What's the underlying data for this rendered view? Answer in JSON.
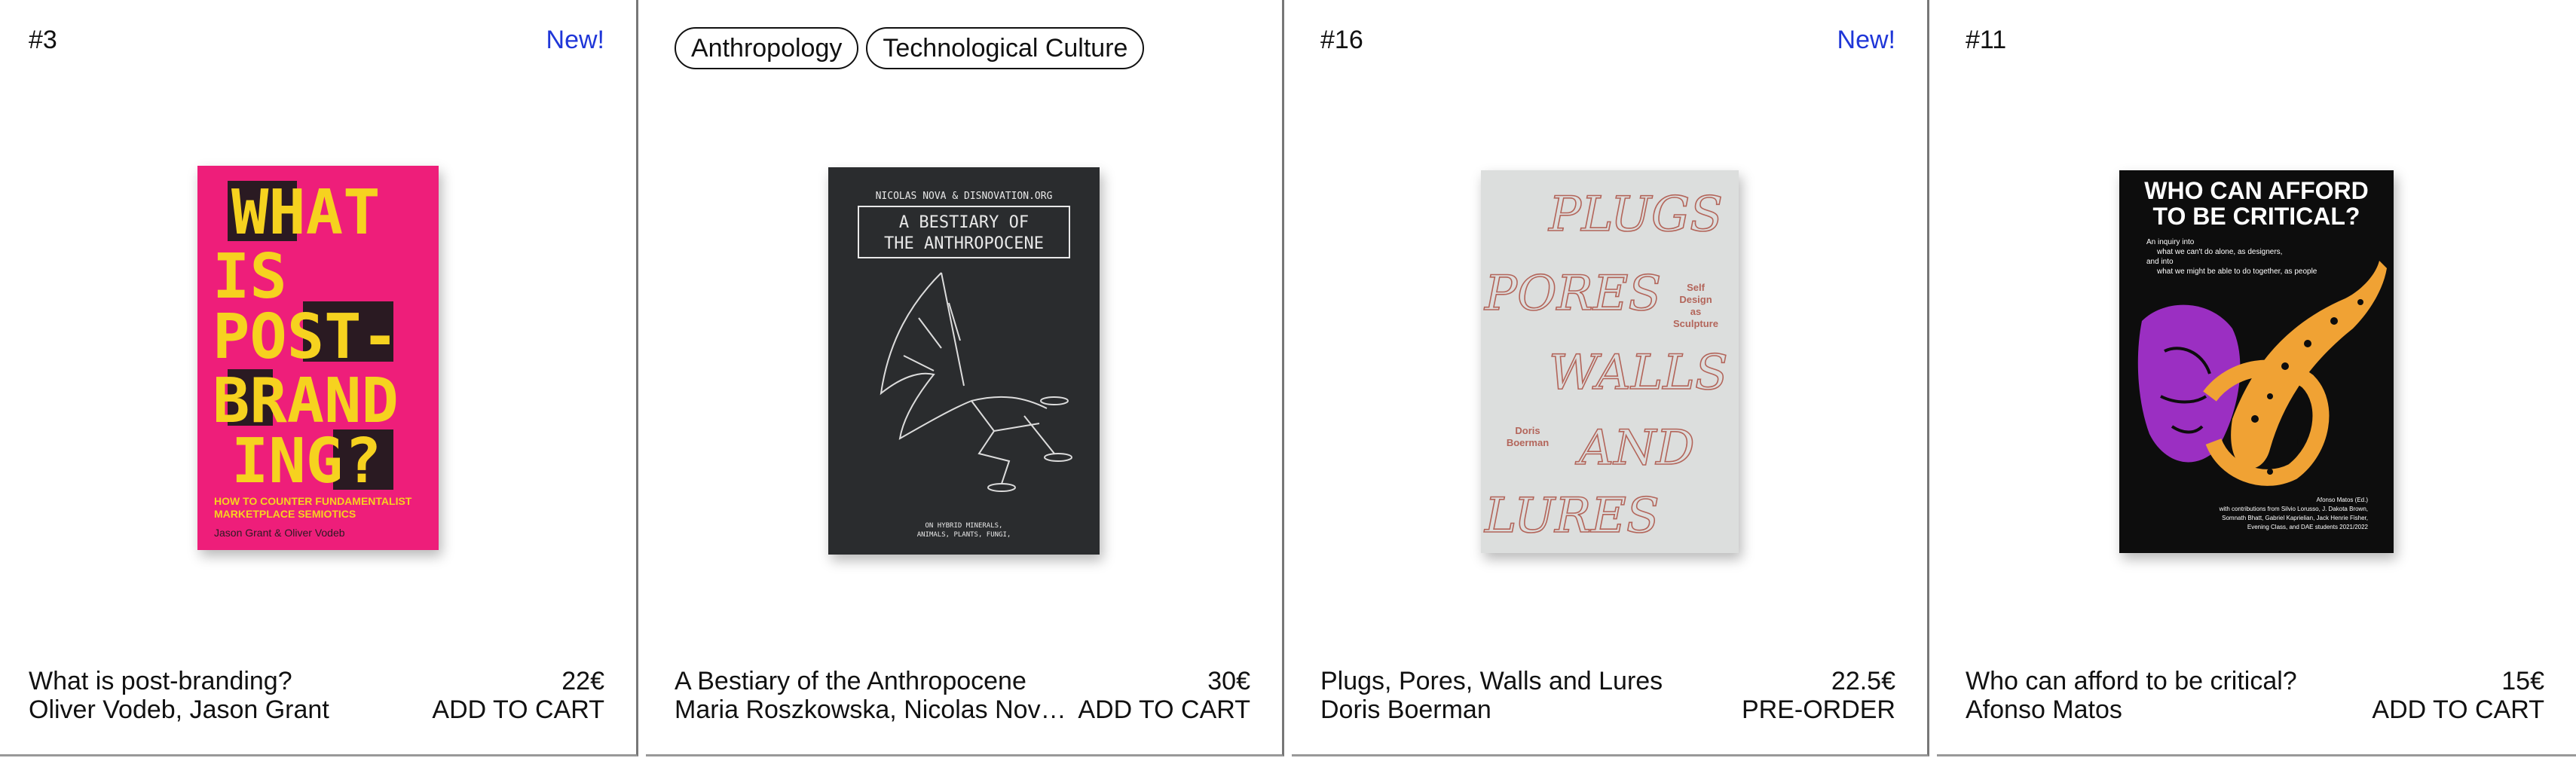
{
  "products": [
    {
      "number": "#3",
      "badge": "New!",
      "cover": {
        "big_lines": [
          "WHAT",
          "IS",
          "POST-",
          "BRAND",
          "ING",
          "?"
        ],
        "subtitle_1": "HOW TO COUNTER FUNDAMENTALIST",
        "subtitle_2": "MARKETPLACE SEMIOTICS",
        "authors": "Jason Grant & Oliver Vodeb",
        "colors": {
          "bg": "#ee1e7a",
          "text": "#f6d21f"
        }
      },
      "title": "What is post-branding?",
      "authors": "Oliver Vodeb, Jason Grant",
      "price": "22€",
      "action": "ADD TO CART"
    },
    {
      "tags": [
        "Anthropology",
        "Technological Culture"
      ],
      "cover": {
        "top_line": "NICOLAS NOVA & DISNOVATION.ORG",
        "title_1": "A BESTIARY OF",
        "title_2": "THE ANTHROPOCENE",
        "bottom_1": "ON HYBRID MINERALS,",
        "bottom_2": "ANIMALS, PLANTS, FUNGI,",
        "colors": {
          "bg": "#2a2c2e",
          "text": "#e8e8e8"
        }
      },
      "title": "A Bestiary of the Anthropocene",
      "authors": "Maria Roszkowska, Nicolas Nova,...",
      "price": "30€",
      "action": "ADD TO CART"
    },
    {
      "number": "#16",
      "badge": "New!",
      "cover": {
        "script_words": [
          "PLUGS",
          "PORES",
          "WALLS",
          "AND",
          "LURES"
        ],
        "side_title": [
          "Self",
          "Design",
          "as",
          "Sculpture"
        ],
        "author_lines": [
          "Doris",
          "Boerman"
        ],
        "colors": {
          "bg": "#dcdedd",
          "text": "#b3655a"
        }
      },
      "title": "Plugs, Pores, Walls and Lures",
      "authors": "Doris Boerman",
      "price": "22.5€",
      "action": "PRE-ORDER"
    },
    {
      "number": "#11",
      "cover": {
        "title_1": "WHO CAN AFFORD",
        "title_2": "TO BE CRITICAL?",
        "desc": [
          "An inquiry into",
          "what we can't do alone, as designers,",
          "and into",
          "what we might be able to do together, as people"
        ],
        "credits": [
          "Afonso Matos (Ed.)",
          "with contributions from Silvio Lorusso, J. Dakota Brown,",
          "Somnath Bhatt, Gabriel Kaprielian, Jack Henrie Fisher,",
          "Evening Class, and DAE students 2021/2022"
        ],
        "colors": {
          "bg": "#0d0d0d",
          "purple": "#9b2fc2",
          "orange": "#f0a234",
          "text": "#ffffff"
        }
      },
      "title": "Who can afford to be critical?",
      "authors": "Afonso Matos",
      "price": "15€",
      "action": "ADD TO CART"
    }
  ]
}
